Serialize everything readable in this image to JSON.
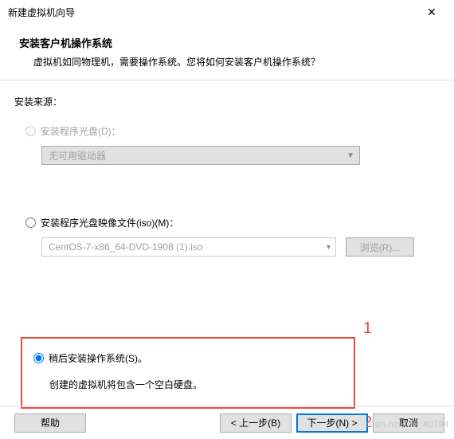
{
  "window": {
    "title": "新建虚拟机向导",
    "close": "✕"
  },
  "header": {
    "heading": "安装客户机操作系统",
    "subtitle": "虚拟机如同物理机，需要操作系统。您将如何安装客户机操作系统？"
  },
  "source_label": "安装来源：",
  "options": {
    "disc": {
      "label": "安装程序光盘(D)：",
      "dropdown": "无可用驱动器"
    },
    "iso": {
      "label": "安装程序光盘映像文件(iso)(M)：",
      "file": "CentOS-7-x86_64-DVD-1908 (1).iso",
      "browse": "浏览(R)..."
    },
    "later": {
      "label": "稍后安装操作系统(S)。",
      "hint": "创建的虚拟机将包含一个空白硬盘。"
    }
  },
  "annotations": {
    "one": "1",
    "two": "2"
  },
  "buttons": {
    "help": "帮助",
    "back": "< 上一步(B)",
    "next": "下一步(N) >",
    "cancel": "取消"
  },
  "watermark": "csdn.net/m0_40794"
}
